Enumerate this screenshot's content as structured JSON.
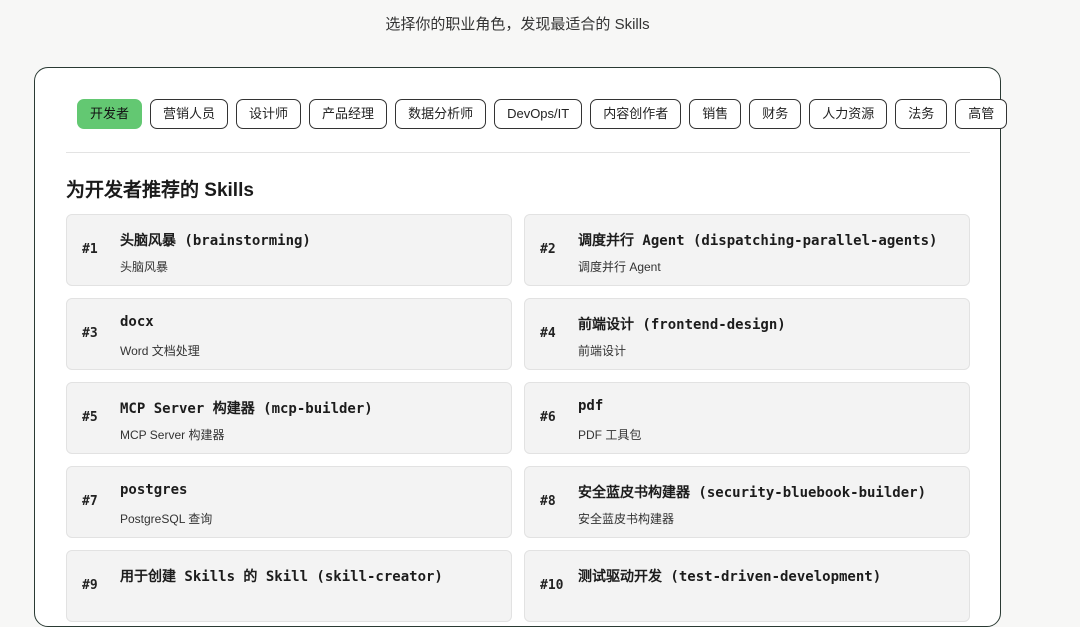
{
  "header": {
    "subtitle": "选择你的职业角色，发现最适合的 Skills"
  },
  "roles": [
    {
      "label": "开发者",
      "active": true
    },
    {
      "label": "营销人员",
      "active": false
    },
    {
      "label": "设计师",
      "active": false
    },
    {
      "label": "产品经理",
      "active": false
    },
    {
      "label": "数据分析师",
      "active": false
    },
    {
      "label": "DevOps/IT",
      "active": false
    },
    {
      "label": "内容创作者",
      "active": false
    },
    {
      "label": "销售",
      "active": false
    },
    {
      "label": "财务",
      "active": false
    },
    {
      "label": "人力资源",
      "active": false
    },
    {
      "label": "法务",
      "active": false
    },
    {
      "label": "高管",
      "active": false
    }
  ],
  "section": {
    "title": "为开发者推荐的 Skills"
  },
  "skills": [
    {
      "rank": "#1",
      "name": "头脑风暴 (brainstorming)",
      "desc": "头脑风暴"
    },
    {
      "rank": "#2",
      "name": "调度并行 Agent (dispatching-parallel-agents)",
      "desc": "调度并行 Agent"
    },
    {
      "rank": "#3",
      "name": "docx",
      "desc": "Word 文档处理"
    },
    {
      "rank": "#4",
      "name": "前端设计 (frontend-design)",
      "desc": "前端设计"
    },
    {
      "rank": "#5",
      "name": "MCP Server 构建器 (mcp-builder)",
      "desc": "MCP Server 构建器"
    },
    {
      "rank": "#6",
      "name": "pdf",
      "desc": "PDF 工具包"
    },
    {
      "rank": "#7",
      "name": "postgres",
      "desc": "PostgreSQL 查询"
    },
    {
      "rank": "#8",
      "name": "安全蓝皮书构建器 (security-bluebook-builder)",
      "desc": "安全蓝皮书构建器"
    },
    {
      "rank": "#9",
      "name": "用于创建 Skills 的 Skill (skill-creator)",
      "desc": ""
    },
    {
      "rank": "#10",
      "name": "测试驱动开发 (test-driven-development)",
      "desc": ""
    }
  ],
  "colors": {
    "active_role": "#63c872",
    "card_border": "#2a3a33",
    "skill_bg": "#f3f3f3"
  }
}
